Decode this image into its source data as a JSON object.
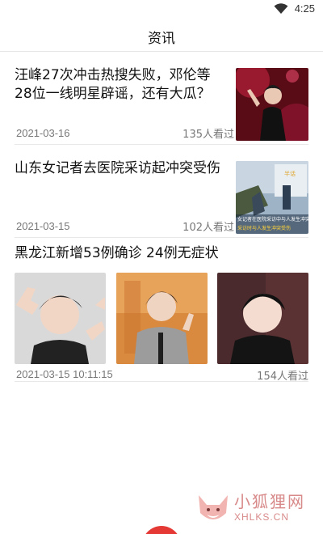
{
  "status_bar": {
    "time": "4:25",
    "icon": "wifi-icon"
  },
  "header": {
    "title": "资讯"
  },
  "news": [
    {
      "title": "汪峰27次冲击热搜失败，邓伦等28位一线明星辟谣，还有大瓜？",
      "date": "2021-03-16",
      "views": "135人看过",
      "thumb": "performer-photo"
    },
    {
      "title": "山东女记者去医院采访起冲突受伤",
      "date": "2021-03-15",
      "views": "102人看过",
      "thumb": "news-footage",
      "thumb_caption_1": "女记者在医院采访中与人发生冲突",
      "thumb_caption_2": "采访时与人发生冲突受伤"
    },
    {
      "title": "黑龙江新增53例确诊 24例无症状",
      "date": "2021-03-15 10:11:15",
      "views": "154人看过",
      "images": [
        "portrait-1",
        "portrait-2",
        "portrait-3"
      ]
    }
  ],
  "watermark": {
    "cn": "小狐狸网",
    "en": "XHLKS.CN"
  },
  "colors": {
    "accent": "#e53935",
    "divider": "#e8e8e8",
    "meta_text": "#777777"
  }
}
